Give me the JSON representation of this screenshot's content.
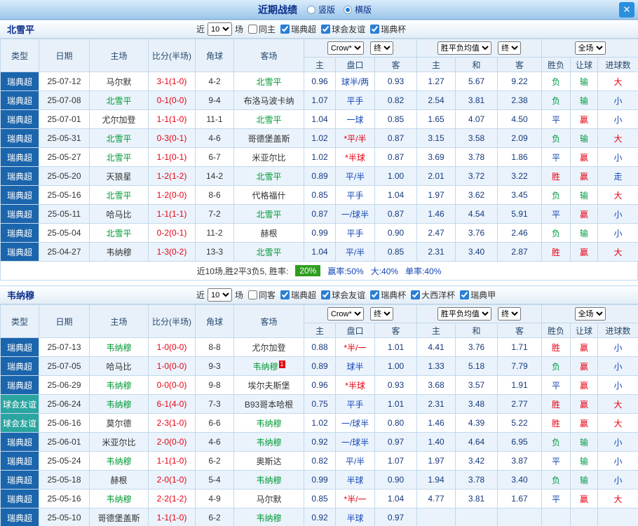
{
  "titlebar": {
    "title": "近期战绩",
    "radios": [
      {
        "label": "竖版",
        "selected": false
      },
      {
        "label": "横版",
        "selected": true
      }
    ],
    "close_label": "✕"
  },
  "colors": {
    "win_red": "#e60012",
    "draw_blue": "#1547b8",
    "lose_green": "#009944",
    "league_swedish_super_bg": "#1b65ad",
    "league_friendly_bg": "#2aa5a0",
    "team_highlight_green": "#009933",
    "odds_navy": "#16387c",
    "win_rate_chip_bg": "#2f9e1e"
  },
  "table_header": {
    "cols": [
      "类型",
      "日期",
      "主场",
      "比分(半场)",
      "角球",
      "客场"
    ],
    "odds_company_select": "Crow*",
    "odds_final_select": "终",
    "europe_select": "胜平负均值",
    "europe_final_select": "终",
    "scope_select": "全场",
    "sub": [
      "主",
      "盘口",
      "客",
      "主",
      "和",
      "客",
      "胜负",
      "让球",
      "进球数"
    ]
  },
  "sections": [
    {
      "team": "北雪平",
      "filters": {
        "near": "近",
        "count": "10",
        "games": "场",
        "checkboxes": [
          {
            "label": "同主",
            "checked": false
          },
          {
            "label": "瑞典超",
            "checked": true
          },
          {
            "label": "球会友谊",
            "checked": true
          },
          {
            "label": "瑞典杯",
            "checked": true
          }
        ]
      },
      "rows": [
        {
          "league": "瑞典超",
          "date": "25-07-12",
          "home": "马尔默",
          "score": "3-1(1-0)",
          "corner": "4-2",
          "away": "北雪平",
          "o1": "0.96",
          "hc": "球半/两",
          "o2": "0.93",
          "e1": "1.27",
          "e2": "5.67",
          "e3": "9.22",
          "r1": "负",
          "r2": "输",
          "r3": "大"
        },
        {
          "league": "瑞典超",
          "date": "25-07-08",
          "home": "北雪平",
          "score": "0-1(0-0)",
          "corner": "9-4",
          "away": "布洛马波卡纳",
          "o1": "1.07",
          "hc": "平手",
          "o2": "0.82",
          "e1": "2.54",
          "e2": "3.81",
          "e3": "2.38",
          "r1": "负",
          "r2": "输",
          "r3": "小"
        },
        {
          "league": "瑞典超",
          "date": "25-07-01",
          "home": "尤尔加登",
          "score": "1-1(1-0)",
          "corner": "11-1",
          "away": "北雪平",
          "o1": "1.04",
          "hc": "一球",
          "o2": "0.85",
          "e1": "1.65",
          "e2": "4.07",
          "e3": "4.50",
          "r1": "平",
          "r2": "赢",
          "r3": "小"
        },
        {
          "league": "瑞典超",
          "date": "25-05-31",
          "home": "北雪平",
          "score": "0-3(0-1)",
          "corner": "4-6",
          "away": "哥德堡盖斯",
          "o1": "1.02",
          "hc": "*平/半",
          "o2": "0.87",
          "e1": "3.15",
          "e2": "3.58",
          "e3": "2.09",
          "r1": "负",
          "r2": "输",
          "r3": "大"
        },
        {
          "league": "瑞典超",
          "date": "25-05-27",
          "home": "北雪平",
          "score": "1-1(0-1)",
          "corner": "6-7",
          "away": "米亚尔比",
          "o1": "1.02",
          "hc": "*半球",
          "o2": "0.87",
          "e1": "3.69",
          "e2": "3.78",
          "e3": "1.86",
          "r1": "平",
          "r2": "赢",
          "r3": "小"
        },
        {
          "league": "瑞典超",
          "date": "25-05-20",
          "home": "天狼星",
          "score": "1-2(1-2)",
          "corner": "14-2",
          "away": "北雪平",
          "o1": "0.89",
          "hc": "平/半",
          "o2": "1.00",
          "e1": "2.01",
          "e2": "3.72",
          "e3": "3.22",
          "r1": "胜",
          "r2": "赢",
          "r3": "走"
        },
        {
          "league": "瑞典超",
          "date": "25-05-16",
          "home": "北雪平",
          "score": "1-2(0-0)",
          "corner": "8-6",
          "away": "代格福什",
          "o1": "0.85",
          "hc": "平手",
          "o2": "1.04",
          "e1": "1.97",
          "e2": "3.62",
          "e3": "3.45",
          "r1": "负",
          "r2": "输",
          "r3": "大"
        },
        {
          "league": "瑞典超",
          "date": "25-05-11",
          "home": "哈马比",
          "score": "1-1(1-1)",
          "corner": "7-2",
          "away": "北雪平",
          "o1": "0.87",
          "hc": "一/球半",
          "o2": "0.87",
          "e1": "1.46",
          "e2": "4.54",
          "e3": "5.91",
          "r1": "平",
          "r2": "赢",
          "r3": "小"
        },
        {
          "league": "瑞典超",
          "date": "25-05-04",
          "home": "北雪平",
          "score": "0-2(0-1)",
          "corner": "11-2",
          "away": "赫根",
          "o1": "0.99",
          "hc": "平手",
          "o2": "0.90",
          "e1": "2.47",
          "e2": "3.76",
          "e3": "2.46",
          "r1": "负",
          "r2": "输",
          "r3": "小"
        },
        {
          "league": "瑞典超",
          "date": "25-04-27",
          "home": "韦纳穆",
          "score": "1-3(0-2)",
          "corner": "13-3",
          "away": "北雪平",
          "o1": "1.04",
          "hc": "平/半",
          "o2": "0.85",
          "e1": "2.31",
          "e2": "3.40",
          "e3": "2.87",
          "r1": "胜",
          "r2": "赢",
          "r3": "大"
        }
      ],
      "summary": {
        "text": "近10场,胜2平3负5, 胜率:",
        "chip": "20%",
        "parts": [
          "赢率:50%",
          "大:40%",
          "单率:40%"
        ]
      }
    },
    {
      "team": "韦纳穆",
      "filters": {
        "near": "近",
        "count": "10",
        "games": "场",
        "checkboxes": [
          {
            "label": "同客",
            "checked": false
          },
          {
            "label": "瑞典超",
            "checked": true
          },
          {
            "label": "球会友谊",
            "checked": true
          },
          {
            "label": "瑞典杯",
            "checked": true
          },
          {
            "label": "大西洋杯",
            "checked": true
          },
          {
            "label": "瑞典甲",
            "checked": true
          }
        ]
      },
      "rows": [
        {
          "league": "瑞典超",
          "date": "25-07-13",
          "home": "韦纳穆",
          "score": "1-0(0-0)",
          "corner": "8-8",
          "away": "尤尔加登",
          "o1": "0.88",
          "hc": "*半/一",
          "o2": "1.01",
          "e1": "4.41",
          "e2": "3.76",
          "e3": "1.71",
          "r1": "胜",
          "r2": "赢",
          "r3": "小"
        },
        {
          "league": "瑞典超",
          "date": "25-07-05",
          "home": "哈马比",
          "score": "1-0(0-0)",
          "corner": "9-3",
          "away": "韦纳穆",
          "away_badge": "1",
          "o1": "0.89",
          "hc": "球半",
          "o2": "1.00",
          "e1": "1.33",
          "e2": "5.18",
          "e3": "7.79",
          "r1": "负",
          "r2": "赢",
          "r3": "小"
        },
        {
          "league": "瑞典超",
          "date": "25-06-29",
          "home": "韦纳穆",
          "score": "0-0(0-0)",
          "corner": "9-8",
          "away": "埃尔夫斯堡",
          "o1": "0.96",
          "hc": "*半球",
          "o2": "0.93",
          "e1": "3.68",
          "e2": "3.57",
          "e3": "1.91",
          "r1": "平",
          "r2": "赢",
          "r3": "小"
        },
        {
          "league": "球会友谊",
          "date": "25-06-24",
          "home": "韦纳穆",
          "score": "6-1(4-0)",
          "corner": "7-3",
          "away": "B93哥本哈根",
          "o1": "0.75",
          "hc": "平手",
          "o2": "1.01",
          "e1": "2.31",
          "e2": "3.48",
          "e3": "2.77",
          "r1": "胜",
          "r2": "赢",
          "r3": "大"
        },
        {
          "league": "球会友谊",
          "date": "25-06-16",
          "home": "莫尔德",
          "score": "2-3(1-0)",
          "corner": "6-6",
          "away": "韦纳穆",
          "o1": "1.02",
          "hc": "一/球半",
          "o2": "0.80",
          "e1": "1.46",
          "e2": "4.39",
          "e3": "5.22",
          "r1": "胜",
          "r2": "赢",
          "r3": "大"
        },
        {
          "league": "瑞典超",
          "date": "25-06-01",
          "home": "米亚尔比",
          "score": "2-0(0-0)",
          "corner": "4-6",
          "away": "韦纳穆",
          "o1": "0.92",
          "hc": "一/球半",
          "o2": "0.97",
          "e1": "1.40",
          "e2": "4.64",
          "e3": "6.95",
          "r1": "负",
          "r2": "输",
          "r3": "小"
        },
        {
          "league": "瑞典超",
          "date": "25-05-24",
          "home": "韦纳穆",
          "score": "1-1(1-0)",
          "corner": "6-2",
          "away": "奥斯达",
          "o1": "0.82",
          "hc": "平/半",
          "o2": "1.07",
          "e1": "1.97",
          "e2": "3.42",
          "e3": "3.87",
          "r1": "平",
          "r2": "输",
          "r3": "小"
        },
        {
          "league": "瑞典超",
          "date": "25-05-18",
          "home": "赫根",
          "score": "2-0(1-0)",
          "corner": "5-4",
          "away": "韦纳穆",
          "o1": "0.99",
          "hc": "半球",
          "o2": "0.90",
          "e1": "1.94",
          "e2": "3.78",
          "e3": "3.40",
          "r1": "负",
          "r2": "输",
          "r3": "小"
        },
        {
          "league": "瑞典超",
          "date": "25-05-16",
          "home": "韦纳穆",
          "score": "2-2(1-2)",
          "corner": "4-9",
          "away": "马尔默",
          "o1": "0.85",
          "hc": "*半/一",
          "o2": "1.04",
          "e1": "4.77",
          "e2": "3.81",
          "e3": "1.67",
          "r1": "平",
          "r2": "赢",
          "r3": "大"
        },
        {
          "league": "瑞典超",
          "date": "25-05-10",
          "home": "哥德堡盖斯",
          "score": "1-1(1-0)",
          "corner": "6-2",
          "away": "韦纳穆",
          "o1": "0.92",
          "hc": "半球",
          "o2": "0.97",
          "e1": "",
          "e2": "",
          "e3": "",
          "r1": "",
          "r2": "",
          "r3": ""
        }
      ],
      "summary": null
    }
  ]
}
